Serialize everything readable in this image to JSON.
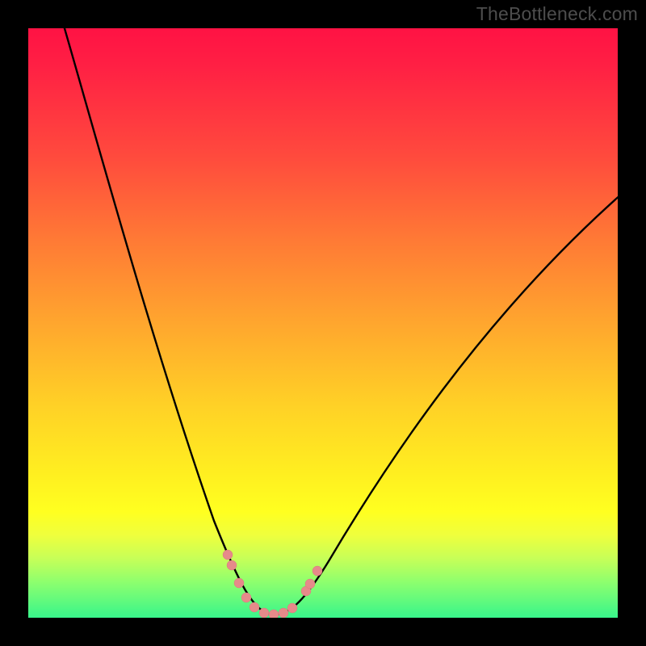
{
  "watermark": "TheBottleneck.com",
  "chart_data": {
    "type": "line",
    "title": "",
    "xlabel": "",
    "ylabel": "",
    "xlim": [
      0,
      100
    ],
    "ylim": [
      0,
      100
    ],
    "note": "V-shaped bottleneck curve. y is % bottleneck (0 optimal at bottom/green, 100 severe at top/red). x is relative component balance. Minimum near x≈40.",
    "series": [
      {
        "name": "bottleneck-curve",
        "x": [
          6,
          10,
          14,
          18,
          22,
          26,
          30,
          33,
          36,
          38,
          40,
          42,
          44,
          46,
          50,
          56,
          64,
          74,
          86,
          100
        ],
        "y": [
          100,
          87,
          74,
          62,
          50,
          39,
          28,
          19,
          11,
          5,
          1,
          0,
          1,
          3,
          8,
          15,
          25,
          37,
          51,
          67
        ]
      }
    ],
    "optimal_band": {
      "x_range": [
        35,
        47
      ],
      "y_max": 9,
      "description": "Pink dotted markers along the bottom of the valley indicating near-optimal balance region."
    },
    "color_scale": {
      "0": "#38f58b",
      "20": "#ffff20",
      "50": "#ffa62e",
      "80": "#ff4b3d",
      "100": "#ff1244"
    }
  }
}
